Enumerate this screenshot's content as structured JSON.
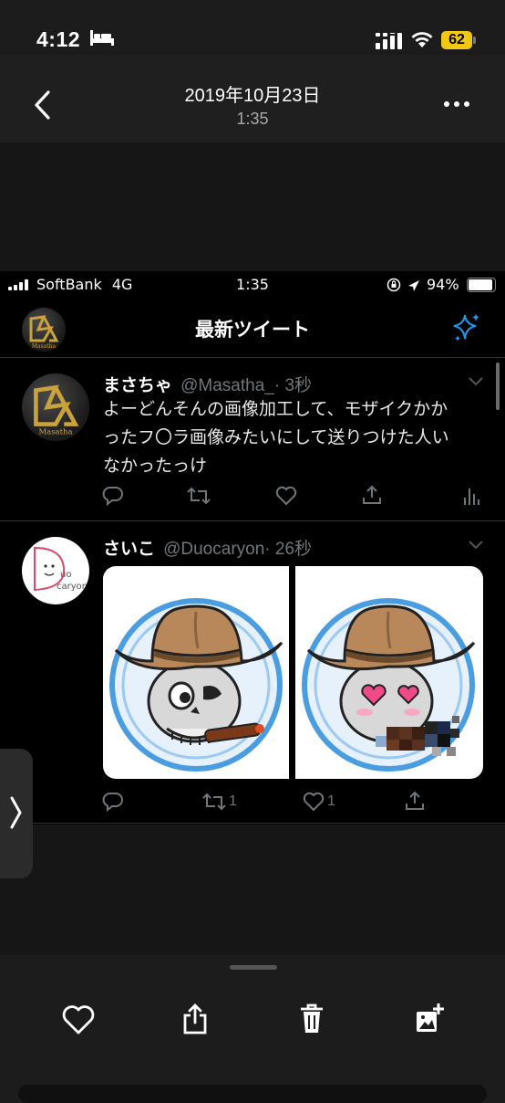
{
  "outer_status": {
    "time": "4:12",
    "battery": "62"
  },
  "viewer": {
    "date": "2019年10月23日",
    "time": "1:35"
  },
  "inner_status": {
    "carrier": "SoftBank",
    "network": "4G",
    "time": "1:35",
    "battery": "94%"
  },
  "twitter": {
    "title": "最新ツイート",
    "header_avatar_text": "Masatha",
    "tweets": [
      {
        "name": "まさちゃ",
        "handle": "@Masatha_",
        "time": "· 3秒",
        "avatar_text": "Masatha",
        "text_lines": [
          "よーどんそんの画像加工して、モザイクかか",
          "ったフ〇ラ画像みたいにして送りつけた人い",
          "なかったっけ"
        ]
      },
      {
        "name": "さいこ",
        "handle": "@Duocaryon",
        "time": "· 26秒",
        "avatar_text_1": "uo",
        "avatar_text_2": "caryon",
        "retweets": "1",
        "likes": "1"
      }
    ]
  },
  "colors": {
    "accent": "#1d9bf0",
    "battery_badge": "#f2c811"
  }
}
